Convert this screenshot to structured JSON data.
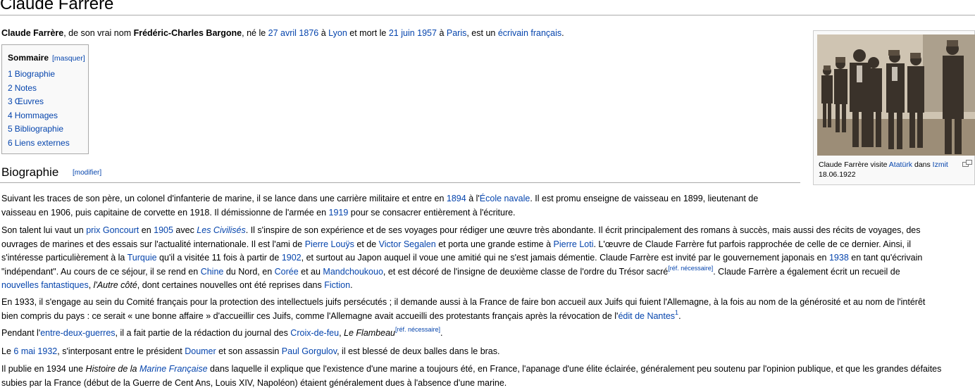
{
  "page": {
    "title": "Claude Farrère"
  },
  "lead": [
    {
      "t": "b",
      "v": "Claude Farrère"
    },
    {
      "t": "s",
      "v": ", de son vrai nom "
    },
    {
      "t": "b",
      "v": "Frédéric-Charles Bargone"
    },
    {
      "t": "s",
      "v": ", né le "
    },
    {
      "t": "a",
      "v": "27 avril 1876"
    },
    {
      "t": "s",
      "v": " à "
    },
    {
      "t": "a",
      "v": "Lyon"
    },
    {
      "t": "s",
      "v": " et mort le "
    },
    {
      "t": "a",
      "v": "21 juin 1957"
    },
    {
      "t": "s",
      "v": " à "
    },
    {
      "t": "a",
      "v": "Paris"
    },
    {
      "t": "s",
      "v": ", est un "
    },
    {
      "t": "a",
      "v": "écrivain français"
    },
    {
      "t": "s",
      "v": "."
    }
  ],
  "toc": {
    "title": "Sommaire",
    "hide_label": "[masquer]",
    "items": [
      {
        "num": "1",
        "label": "Biographie"
      },
      {
        "num": "2",
        "label": "Notes"
      },
      {
        "num": "3",
        "label": "Œuvres"
      },
      {
        "num": "4",
        "label": "Hommages"
      },
      {
        "num": "5",
        "label": "Bibliographie"
      },
      {
        "num": "6",
        "label": "Liens externes"
      }
    ]
  },
  "thumb": {
    "caption": [
      {
        "t": "s",
        "v": "Claude Farrère visite "
      },
      {
        "t": "a",
        "v": "Atatürk"
      },
      {
        "t": "s",
        "v": " dans "
      },
      {
        "t": "a",
        "v": "Izmit"
      },
      {
        "t": "br"
      },
      {
        "t": "s",
        "v": "18.06.1922"
      }
    ]
  },
  "section": {
    "title": "Biographie",
    "edit_label": "[modifier]"
  },
  "paragraphs": [
    [
      {
        "t": "s",
        "v": "Suivant les traces de son père, un colonel d'infanterie de marine, il se lance dans une carrière militaire et entre en "
      },
      {
        "t": "a",
        "v": "1894"
      },
      {
        "t": "s",
        "v": " à l'"
      },
      {
        "t": "a",
        "v": "École navale"
      },
      {
        "t": "s",
        "v": ". Il est promu enseigne de vaisseau en 1899, lieutenant de"
      },
      {
        "t": "br"
      },
      {
        "t": "s",
        "v": "vaisseau en 1906, puis capitaine de corvette en 1918. Il démissionne de l'armée en "
      },
      {
        "t": "a",
        "v": "1919"
      },
      {
        "t": "s",
        "v": " pour se consacrer entièrement à l'écriture."
      }
    ],
    [
      {
        "t": "s",
        "v": "Son talent lui vaut un "
      },
      {
        "t": "a",
        "v": "prix Goncourt"
      },
      {
        "t": "s",
        "v": " en "
      },
      {
        "t": "a",
        "v": "1905"
      },
      {
        "t": "s",
        "v": " avec "
      },
      {
        "t": "ai",
        "v": "Les Civilisés"
      },
      {
        "t": "s",
        "v": ". Il s'inspire de son expérience et de ses voyages pour rédiger une œuvre très abondante. Il écrit principalement des romans à succès, mais aussi des récits de voyages, des"
      },
      {
        "t": "br"
      },
      {
        "t": "s",
        "v": "ouvrages de marines et des essais sur l'actualité internationale. Il est l'ami de "
      },
      {
        "t": "a",
        "v": "Pierre Louÿs"
      },
      {
        "t": "s",
        "v": " et de "
      },
      {
        "t": "a",
        "v": "Victor Segalen"
      },
      {
        "t": "s",
        "v": " et porta une grande estime à "
      },
      {
        "t": "a",
        "v": "Pierre Loti"
      },
      {
        "t": "s",
        "v": ". L'œuvre de Claude Farrère fut parfois rapprochée de celle de ce dernier. Ainsi, il"
      },
      {
        "t": "br"
      },
      {
        "t": "s",
        "v": "s'intéresse particulièrement à la "
      },
      {
        "t": "a",
        "v": "Turquie"
      },
      {
        "t": "s",
        "v": " qu'il a visitée 11 fois à partir de "
      },
      {
        "t": "a",
        "v": "1902"
      },
      {
        "t": "s",
        "v": ", et surtout au Japon auquel il voue une amitié qui ne s'est jamais démentie. Claude Farrère est invité par le gouvernement japonais en "
      },
      {
        "t": "a",
        "v": "1938"
      },
      {
        "t": "s",
        "v": " en tant qu'écrivain"
      },
      {
        "t": "br"
      },
      {
        "t": "s",
        "v": "\"indépendant\". Au cours de ce séjour, il se rend en "
      },
      {
        "t": "a",
        "v": "Chine"
      },
      {
        "t": "s",
        "v": " du Nord, en "
      },
      {
        "t": "a",
        "v": "Corée"
      },
      {
        "t": "s",
        "v": " et au "
      },
      {
        "t": "a",
        "v": "Mandchoukouo"
      },
      {
        "t": "s",
        "v": ", et est décoré de l'insigne de deuxième classe de l'ordre du Trésor sacré"
      },
      {
        "t": "sup",
        "v": "[réf. nécessaire]"
      },
      {
        "t": "s",
        "v": ". Claude Farrère a également écrit un recueil de"
      },
      {
        "t": "br"
      },
      {
        "t": "a",
        "v": "nouvelles fantastiques"
      },
      {
        "t": "s",
        "v": ", "
      },
      {
        "t": "i",
        "v": "l'Autre côté"
      },
      {
        "t": "s",
        "v": ", dont certaines nouvelles ont été reprises dans "
      },
      {
        "t": "a",
        "v": "Fiction"
      },
      {
        "t": "s",
        "v": "."
      }
    ],
    [
      {
        "t": "s",
        "v": "En 1933, il s'engage au sein du Comité français pour la protection des intellectuels juifs persécutés ; il demande aussi à la France de faire bon accueil aux Juifs qui fuient l'Allemagne, à la fois au nom de la générosité et au nom de l'intérêt"
      },
      {
        "t": "br"
      },
      {
        "t": "s",
        "v": "bien compris du pays : ce serait « une bonne affaire » d'accueillir ces Juifs, comme l'Allemagne avait accueilli des protestants français après la révocation de l'"
      },
      {
        "t": "a",
        "v": "édit de Nantes"
      },
      {
        "t": "sup",
        "v": "1"
      },
      {
        "t": "s",
        "v": "."
      }
    ],
    [
      {
        "t": "s",
        "v": "Pendant l'"
      },
      {
        "t": "a",
        "v": "entre-deux-guerres"
      },
      {
        "t": "s",
        "v": ", il a fait partie de la rédaction du journal des "
      },
      {
        "t": "a",
        "v": "Croix-de-feu"
      },
      {
        "t": "s",
        "v": ", "
      },
      {
        "t": "i",
        "v": "Le Flambeau"
      },
      {
        "t": "sup",
        "v": "[réf. nécessaire]"
      },
      {
        "t": "s",
        "v": "."
      }
    ],
    [
      {
        "t": "s",
        "v": "Le "
      },
      {
        "t": "a",
        "v": "6 mai 1932"
      },
      {
        "t": "s",
        "v": ", s'interposant entre le président "
      },
      {
        "t": "a",
        "v": "Doumer"
      },
      {
        "t": "s",
        "v": " et son assassin "
      },
      {
        "t": "a",
        "v": "Paul Gorgulov"
      },
      {
        "t": "s",
        "v": ", il est blessé de deux balles dans le bras."
      }
    ],
    [
      {
        "t": "s",
        "v": "Il publie en 1934 une "
      },
      {
        "t": "i",
        "v": "Histoire de la "
      },
      {
        "t": "ai",
        "v": "Marine Française"
      },
      {
        "t": "s",
        "v": " dans laquelle il explique que l'existence d'une marine a toujours été, en France, l'apanage d'une élite éclairée, généralement peu soutenu par l'opinion publique, et que les grandes défaites"
      },
      {
        "t": "br"
      },
      {
        "t": "s",
        "v": "subies par la France (début de la Guerre de Cent Ans, Louis XIV, Napoléon) étaient généralement dues à l'absence d'une marine."
      }
    ]
  ]
}
